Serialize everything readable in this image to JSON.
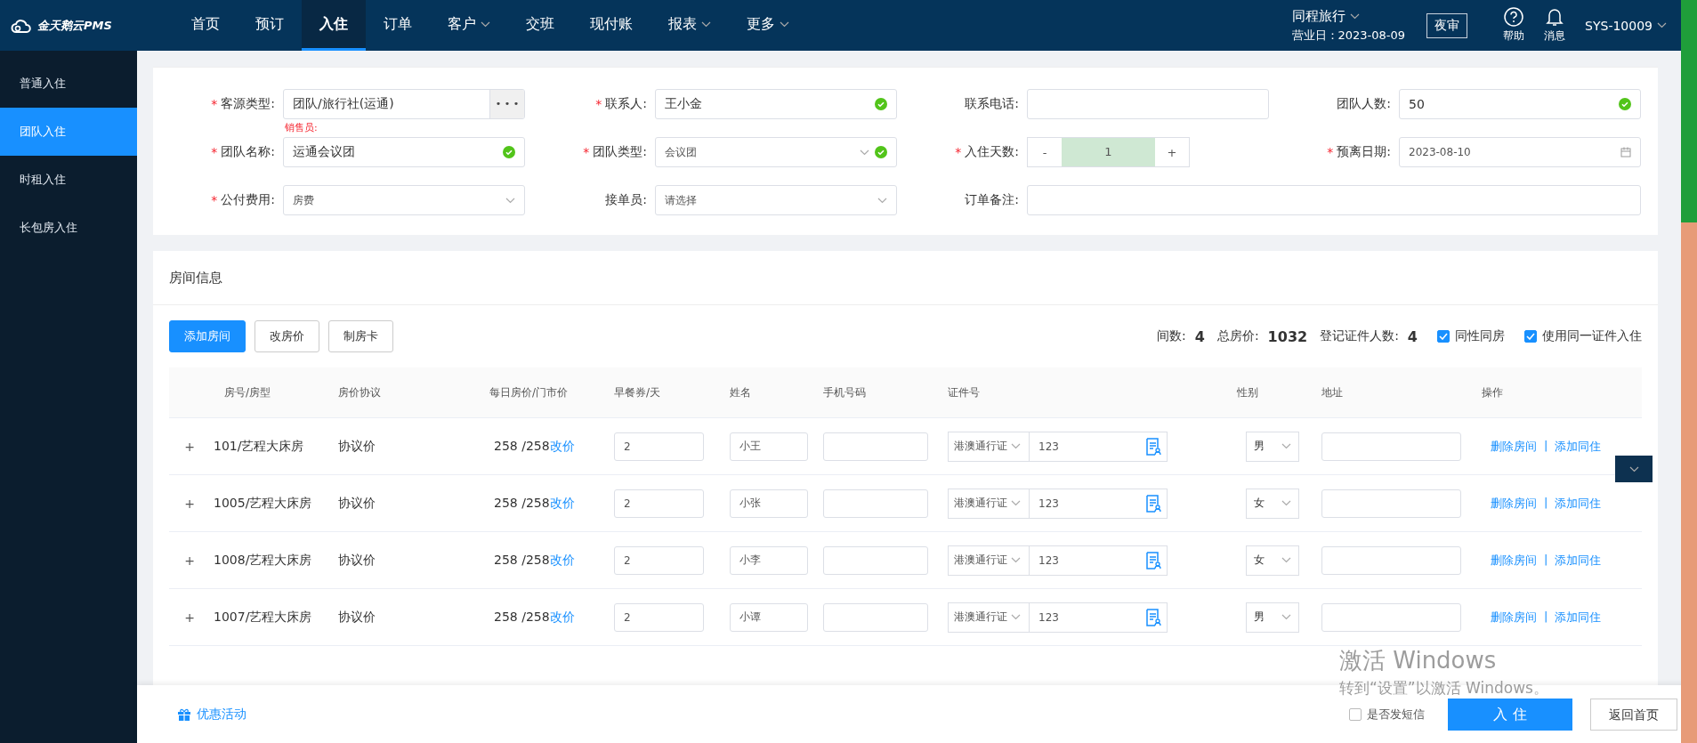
{
  "topbar": {
    "logo": "金天鹅云PMS",
    "nav": [
      {
        "label": "首页",
        "dropdown": false,
        "selected": false
      },
      {
        "label": "预订",
        "dropdown": false,
        "selected": false
      },
      {
        "label": "入住",
        "dropdown": false,
        "selected": true
      },
      {
        "label": "订单",
        "dropdown": false,
        "selected": false
      },
      {
        "label": "客户",
        "dropdown": true,
        "selected": false
      },
      {
        "label": "交班",
        "dropdown": false,
        "selected": false
      },
      {
        "label": "现付账",
        "dropdown": false,
        "selected": false
      },
      {
        "label": "报表",
        "dropdown": true,
        "selected": false
      },
      {
        "label": "更多",
        "dropdown": true,
        "selected": false
      }
    ],
    "hotel": "同程旅行",
    "business_date": "营业日：2023-08-09",
    "night_audit": "夜审",
    "help": "帮助",
    "messages": "消息",
    "user": "SYS-10009"
  },
  "sidebar": {
    "items": [
      {
        "label": "普通入住",
        "selected": false
      },
      {
        "label": "团队入住",
        "selected": true
      },
      {
        "label": "时租入住",
        "selected": false
      },
      {
        "label": "长包房入住",
        "selected": false
      }
    ]
  },
  "form": {
    "sales_note": "销售员:",
    "required_mark": "*",
    "fields": [
      {
        "kind": "picker",
        "label": "客源类型:",
        "required": true,
        "value": "团队/旅行社(运通)",
        "button": "• • •"
      },
      {
        "kind": "text",
        "label": "联系人:",
        "required": true,
        "value": "王小金",
        "valid": true
      },
      {
        "kind": "text",
        "label": "联系电话:",
        "required": false,
        "valid": false
      },
      {
        "kind": "text",
        "label": "团队人数:",
        "required": false,
        "value": "50",
        "valid": true
      },
      {
        "kind": "text",
        "label": "团队名称:",
        "required": true,
        "value": "运通会议团",
        "valid": true
      },
      {
        "kind": "select",
        "label": "团队类型:",
        "required": true,
        "value": "会议团",
        "valid": true
      },
      {
        "kind": "stepper",
        "label": "入住天数:",
        "required": true,
        "value": "1",
        "minus": "-",
        "plus": "+"
      },
      {
        "kind": "date",
        "label": "预离日期:",
        "required": true,
        "value": "2023-08-10"
      },
      {
        "kind": "select",
        "label": "公付费用:",
        "required": true,
        "value": "房费",
        "valid": false
      },
      {
        "kind": "select",
        "label": "接单员:",
        "required": false,
        "placeholder": "请选择",
        "valid": false
      },
      {
        "kind": "wide",
        "label": "订单备注:",
        "required": false,
        "valid": false
      }
    ]
  },
  "rooms": {
    "title": "房间信息",
    "buttons": [
      {
        "label": "添加房间",
        "kind": "primary"
      },
      {
        "label": "改房价",
        "kind": "default"
      },
      {
        "label": "制房卡",
        "kind": "default"
      }
    ],
    "stats": [
      {
        "label": "间数:",
        "value": "4"
      },
      {
        "label": "总房价:",
        "value": "1032"
      },
      {
        "label": "登记证件人数:",
        "value": "4"
      }
    ],
    "options": [
      {
        "label": "同性同房",
        "checked": true
      },
      {
        "label": "使用同一证件入住",
        "checked": true
      }
    ],
    "columns": [
      "房号/房型",
      "房价协议",
      "每日房价/门市价",
      "早餐券/天",
      "姓名",
      "手机号码",
      "证件号",
      "性别",
      "地址",
      "操作"
    ],
    "rows": [
      {
        "expand": "+",
        "room": "101/艺程大床房",
        "agreement": "协议价",
        "price": "258 /258",
        "change_price": "改价",
        "breakfast": "2",
        "name": "小王",
        "phone": "",
        "id_type": "港澳通行证",
        "id_no": "123",
        "gender": "男",
        "address": "",
        "delete": "删除房间",
        "separator": "|",
        "add_guest": "添加同住"
      },
      {
        "expand": "+",
        "room": "1005/艺程大床房",
        "agreement": "协议价",
        "price": "258 /258",
        "change_price": "改价",
        "breakfast": "2",
        "name": "小张",
        "phone": "",
        "id_type": "港澳通行证",
        "id_no": "123",
        "gender": "女",
        "address": "",
        "delete": "删除房间",
        "separator": "|",
        "add_guest": "添加同住"
      },
      {
        "expand": "+",
        "room": "1008/艺程大床房",
        "agreement": "协议价",
        "price": "258 /258",
        "change_price": "改价",
        "breakfast": "2",
        "name": "小李",
        "phone": "",
        "id_type": "港澳通行证",
        "id_no": "123",
        "gender": "女",
        "address": "",
        "delete": "删除房间",
        "separator": "|",
        "add_guest": "添加同住"
      },
      {
        "expand": "+",
        "room": "1007/艺程大床房",
        "agreement": "协议价",
        "price": "258 /258",
        "change_price": "改价",
        "breakfast": "2",
        "name": "小谭",
        "phone": "",
        "id_type": "港澳通行证",
        "id_no": "123",
        "gender": "男",
        "address": "",
        "delete": "删除房间",
        "separator": "|",
        "add_guest": "添加同住"
      }
    ]
  },
  "footer": {
    "promo": "优惠活动",
    "sms": {
      "label": "是否发短信",
      "checked": false
    },
    "submit": "入 住",
    "back": "返回首页"
  },
  "os_notice": {
    "title": "激活 Windows",
    "text": "转到“设置”以激活 Windows。"
  }
}
